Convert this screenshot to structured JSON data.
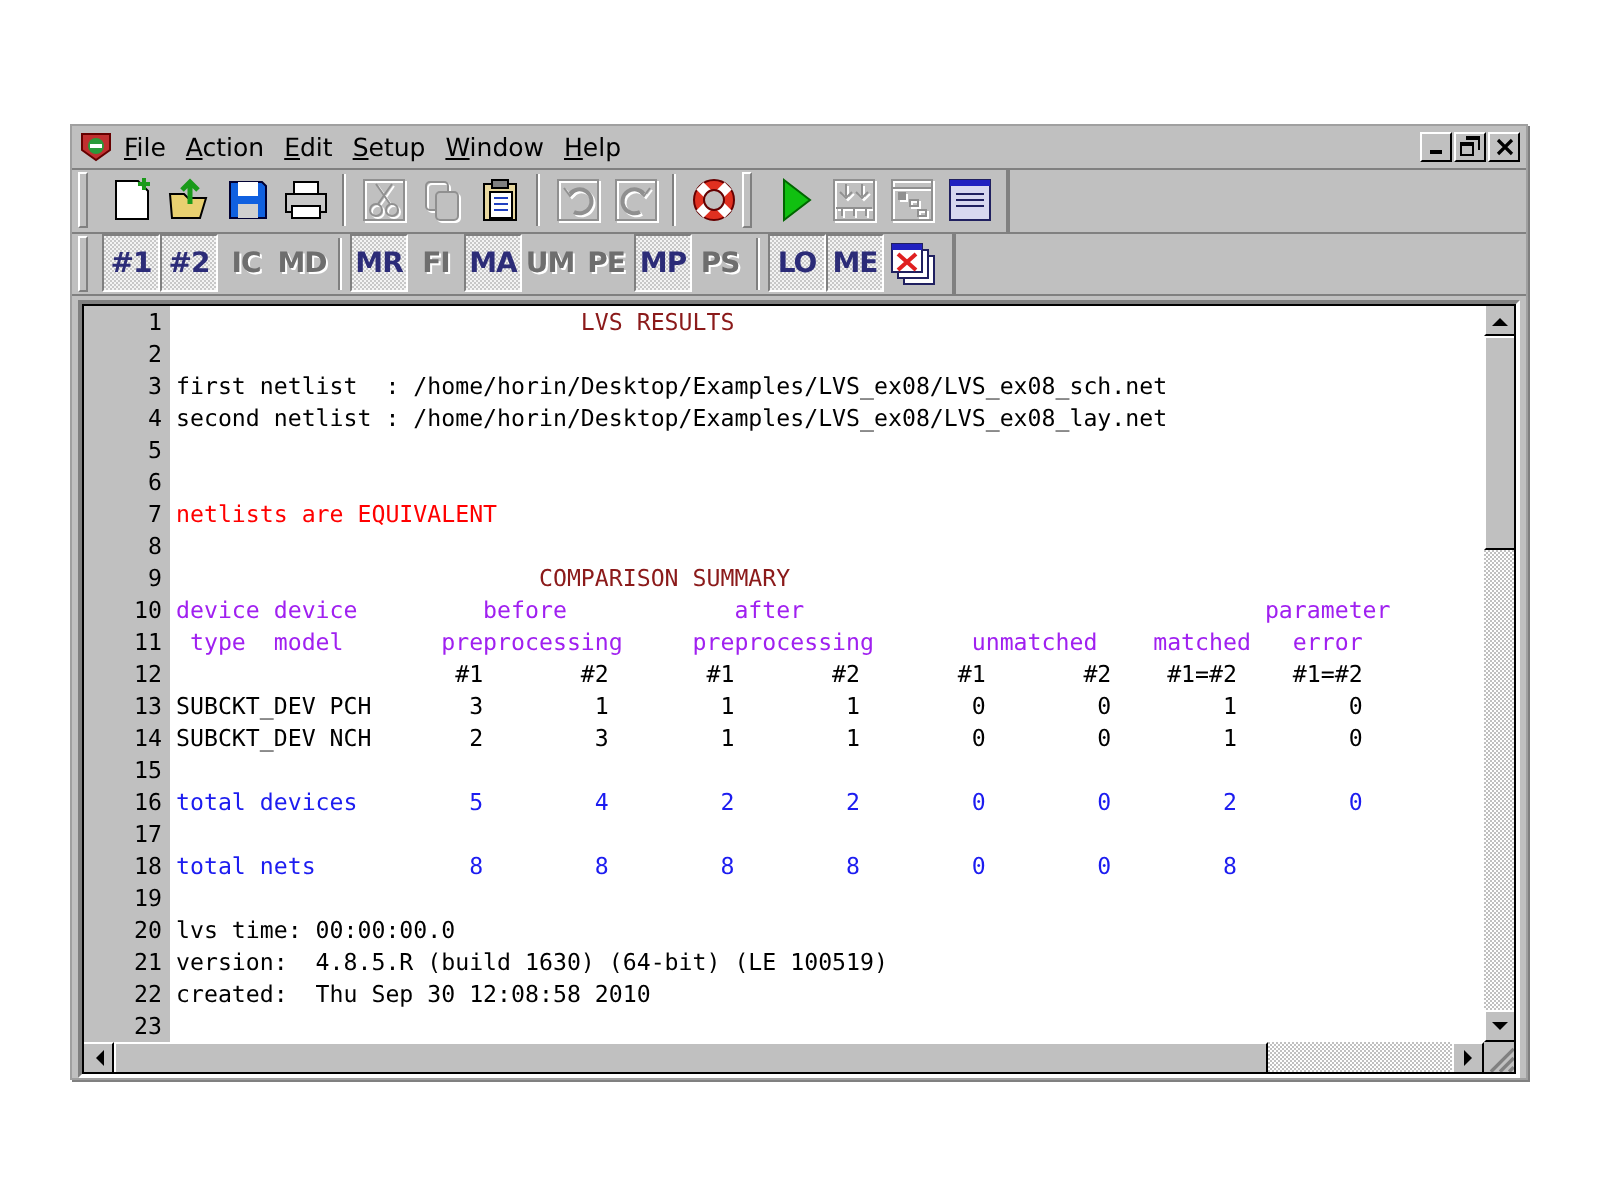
{
  "menu": [
    {
      "label": "File"
    },
    {
      "label": "Action"
    },
    {
      "label": "Edit"
    },
    {
      "label": "Setup"
    },
    {
      "label": "Window"
    },
    {
      "label": "Help"
    }
  ],
  "toolbar_1": [
    {
      "groups": [
        {
          "buttons": [
            {
              "disabled": false
            },
            {
              "disabled": false
            },
            {
              "disabled": false
            },
            {
              "disabled": false
            }
          ]
        },
        {
          "buttons": [
            {
              "disabled": true
            },
            {
              "disabled": true
            },
            {
              "disabled": false
            }
          ]
        },
        {
          "buttons": [
            {
              "disabled": true
            },
            {
              "disabled": true
            }
          ]
        },
        {
          "buttons": [
            {
              "disabled": false
            }
          ]
        }
      ]
    },
    {
      "groups": [
        {
          "buttons": [
            {
              "disabled": false
            },
            {
              "disabled": true
            },
            {
              "disabled": true
            },
            {
              "disabled": false
            }
          ]
        }
      ]
    }
  ],
  "toolbar_2": [
    {
      "groups": [
        {
          "buttons": [
            {
              "kind": "text",
              "label": "#1",
              "on": true
            },
            {
              "kind": "text",
              "label": "#2",
              "on": true
            },
            {
              "kind": "text",
              "label": "IC",
              "on": false
            },
            {
              "kind": "text",
              "label": "MD",
              "on": false
            }
          ]
        },
        {
          "buttons": [
            {
              "kind": "text",
              "label": "MR",
              "on": true
            },
            {
              "kind": "text",
              "label": "FI",
              "on": false
            },
            {
              "kind": "text",
              "label": "MA",
              "on": true
            },
            {
              "kind": "text",
              "label": "UM",
              "on": false
            },
            {
              "kind": "text",
              "label": "PE",
              "on": false
            },
            {
              "kind": "text",
              "label": "MP",
              "on": true
            },
            {
              "kind": "text",
              "label": "PS",
              "on": false
            }
          ]
        },
        {
          "buttons": [
            {
              "kind": "text",
              "label": "LO",
              "on": true
            },
            {
              "kind": "text",
              "label": "ME",
              "on": true
            },
            {
              "kind": "icon"
            }
          ]
        }
      ]
    }
  ],
  "lines": [
    {
      "number": "1",
      "kind": "title",
      "text": "                             LVS RESULTS"
    },
    {
      "number": "2"
    },
    {
      "number": "3",
      "kind": "plain",
      "text": "first netlist  : /home/horin/Desktop/Examples/LVS_ex08/LVS_ex08_sch.net"
    },
    {
      "number": "4",
      "kind": "plain",
      "text": "second netlist : /home/horin/Desktop/Examples/LVS_ex08/LVS_ex08_lay.net"
    },
    {
      "number": "5"
    },
    {
      "number": "6"
    },
    {
      "number": "7",
      "kind": "alert",
      "text": "netlists are EQUIVALENT"
    },
    {
      "number": "8"
    },
    {
      "number": "9",
      "kind": "title",
      "text": "                          COMPARISON SUMMARY"
    },
    {
      "number": "10",
      "kind": "header",
      "text": "device device         before            after                                 parameter"
    },
    {
      "number": "11",
      "kind": "header",
      "text": " type  model       preprocessing     preprocessing       unmatched    matched   error"
    },
    {
      "number": "12",
      "kind": "plain",
      "text": "                    #1       #2       #1       #2       #1       #2    #1=#2    #1=#2"
    },
    {
      "number": "13",
      "kind": "plain",
      "text": "SUBCKT_DEV PCH       3        1        1        1        0        0        1        0"
    },
    {
      "number": "14",
      "kind": "plain",
      "text": "SUBCKT_DEV NCH       2        3        1        1        0        0        1        0"
    },
    {
      "number": "15"
    },
    {
      "number": "16",
      "kind": "total",
      "text": "total devices        5        4        2        2        0        0        2        0"
    },
    {
      "number": "17"
    },
    {
      "number": "18",
      "kind": "total",
      "text": "total nets           8        8        8        8        0        0        8"
    },
    {
      "number": "19"
    },
    {
      "number": "20",
      "kind": "plain",
      "text": "lvs time: 00:00:00.0"
    },
    {
      "number": "21",
      "kind": "plain",
      "text": "version:  4.8.5.R (build 1630) (64-bit) (LE 100519)"
    },
    {
      "number": "22",
      "kind": "plain",
      "text": "created:  Thu Sep 30 12:08:58 2010"
    },
    {
      "number": "23"
    }
  ]
}
